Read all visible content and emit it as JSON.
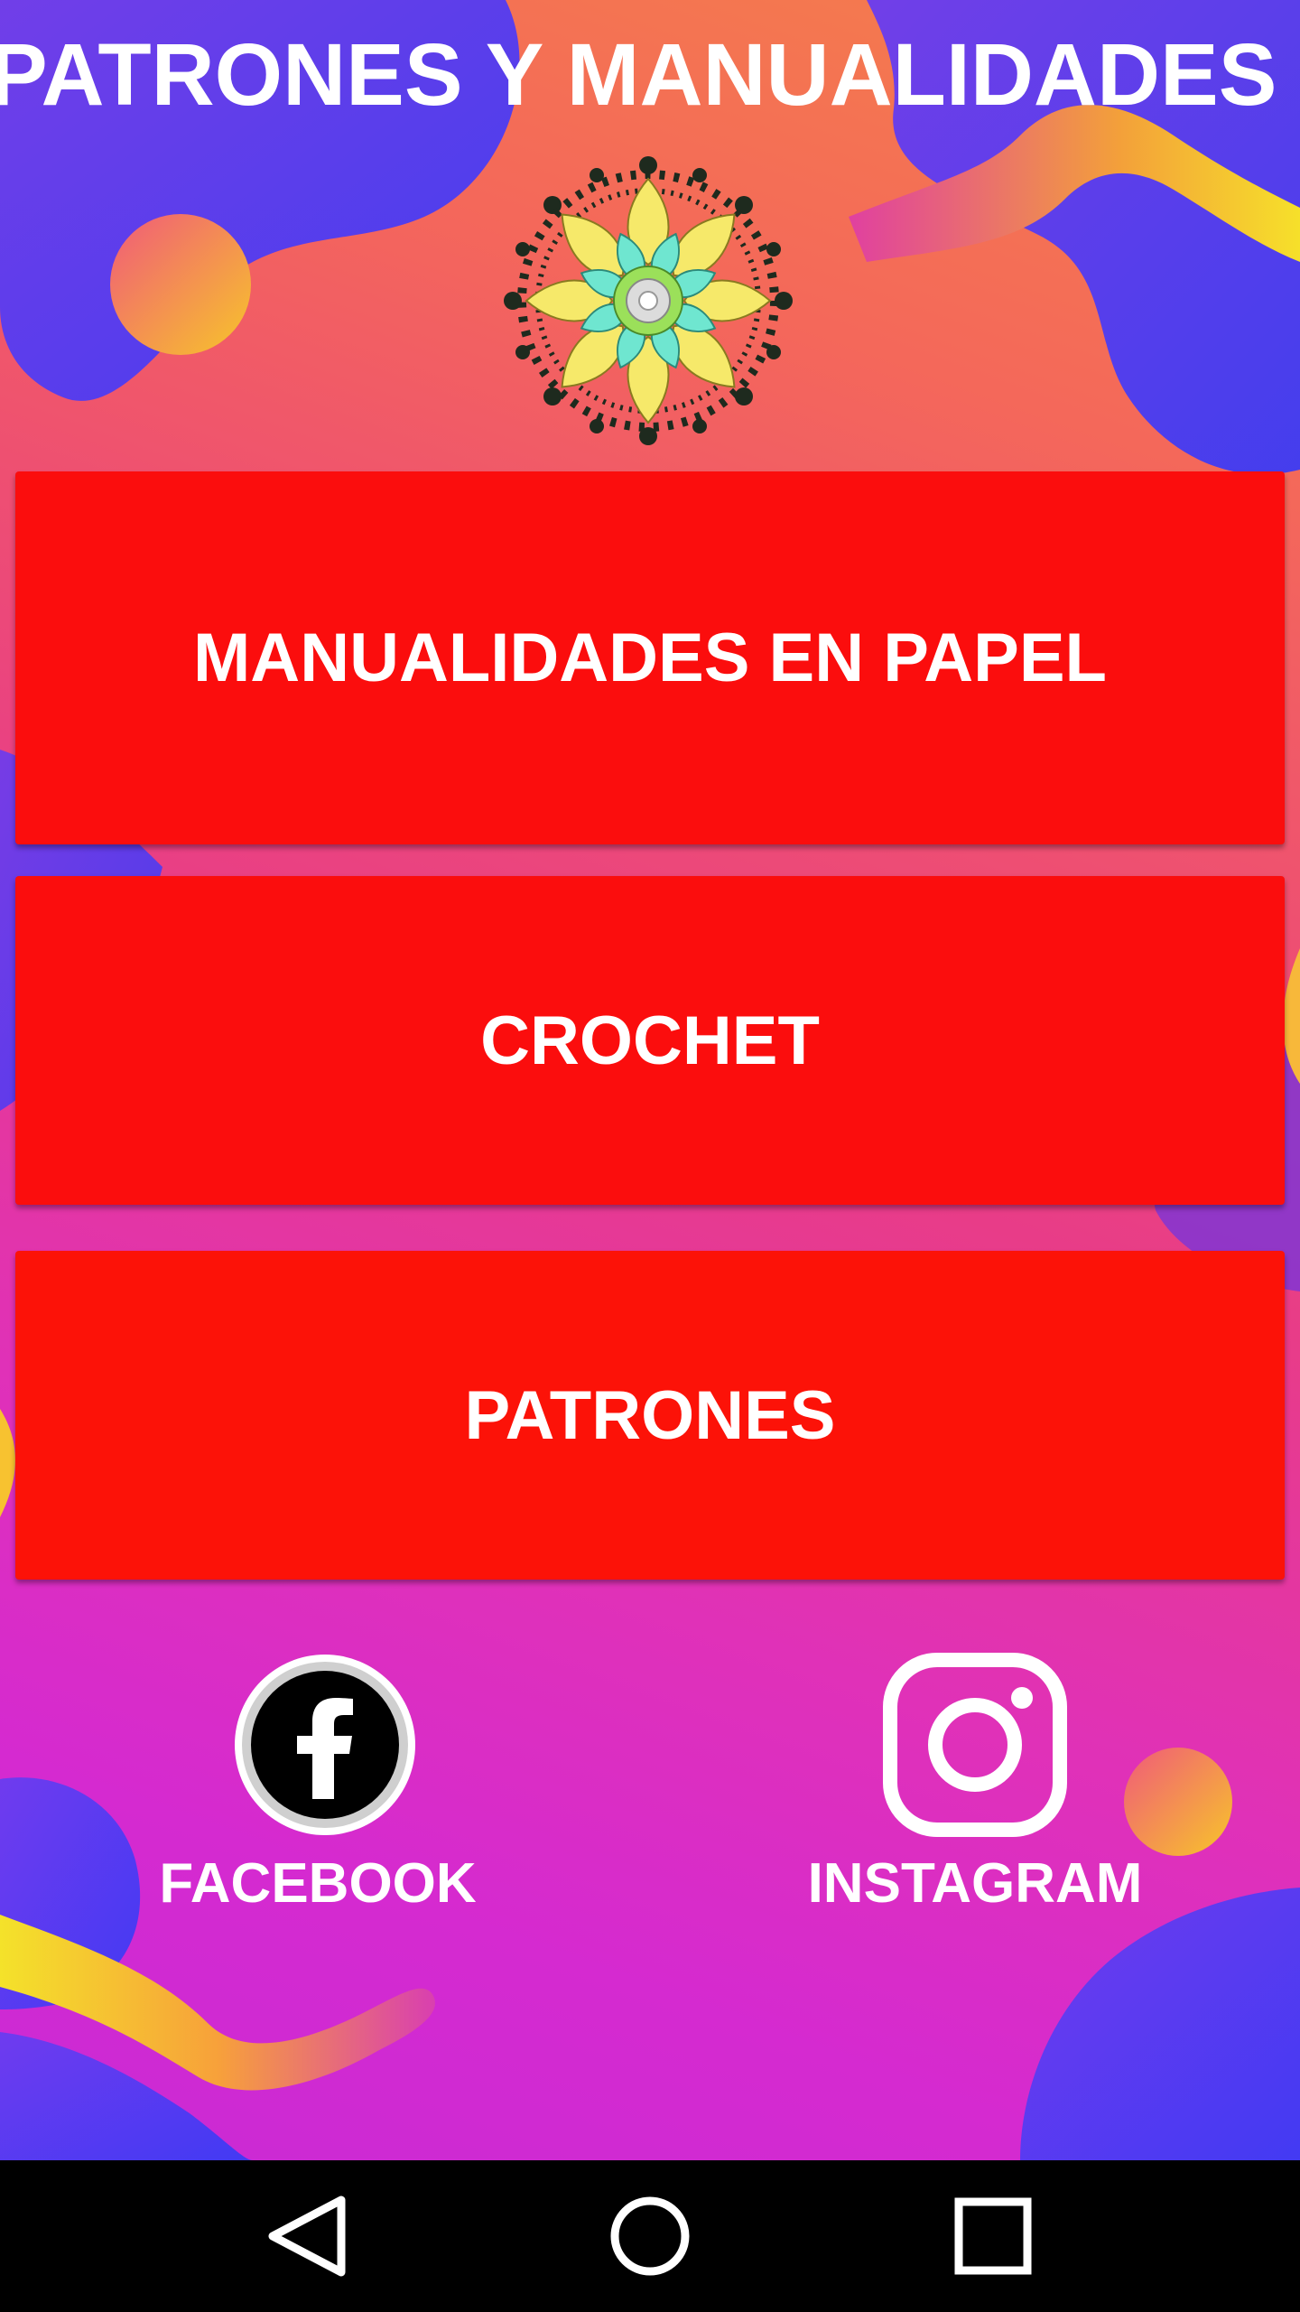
{
  "app": {
    "title": "PATRONES Y MANUALIDADES VIP"
  },
  "menu": {
    "buttons": [
      {
        "label": "MANUALIDADES EN PAPEL"
      },
      {
        "label": "CROCHET"
      },
      {
        "label": "PATRONES"
      }
    ]
  },
  "social": {
    "facebook": {
      "label": "FACEBOOK",
      "icon": "facebook-icon"
    },
    "instagram": {
      "label": "INSTAGRAM",
      "icon": "instagram-icon"
    }
  },
  "navigation": {
    "back_icon": "back-triangle-icon",
    "home_icon": "home-circle-icon",
    "recents_icon": "recents-square-icon"
  },
  "colors": {
    "button_red": "#fb0d0d",
    "text_white": "#ffffff",
    "nav_bar": "#000000"
  }
}
